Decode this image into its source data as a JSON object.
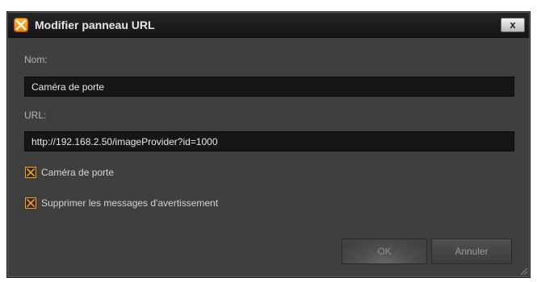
{
  "window": {
    "title": "Modifier panneau URL",
    "close_label": "x"
  },
  "form": {
    "name_label": "Nom:",
    "name_value": "Caméra de porte",
    "url_label": "URL:",
    "url_value": "http://192.168.2.50/imageProvider?id=1000"
  },
  "options": [
    {
      "label": "Caméra de porte",
      "checked": true
    },
    {
      "label": "Supprimer les messages d'avertissement",
      "checked": true
    }
  ],
  "buttons": {
    "ok_label": "OK",
    "cancel_label": "Annuler"
  },
  "icons": {
    "app": "app-logo-icon",
    "check": "checkmark-icon",
    "resize": "resize-grip-icon"
  },
  "colors": {
    "accent": "#ff9c1a",
    "dialog_bg": "#3f3f3f",
    "titlebar_bg": "#1c1c1c",
    "field_bg": "#161616"
  }
}
